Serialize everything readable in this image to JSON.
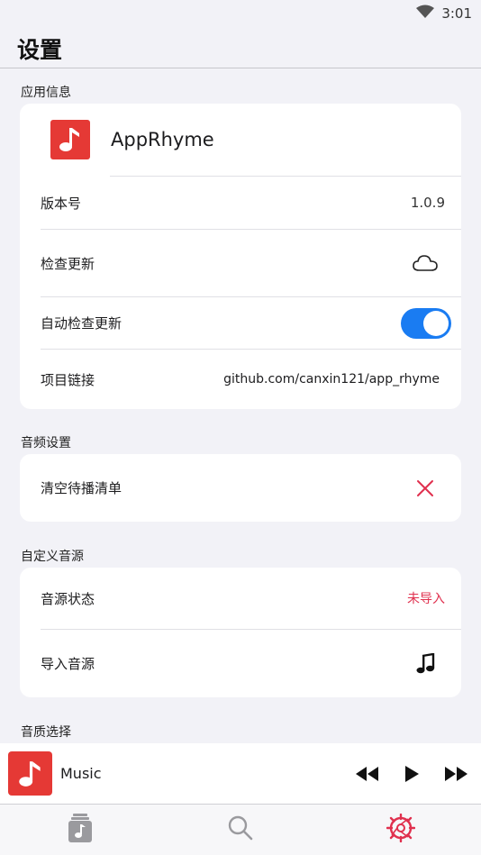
{
  "status": {
    "time": "3:01"
  },
  "page": {
    "title": "设置"
  },
  "sections": {
    "app_info": {
      "header": "应用信息",
      "app_name": "AppRhyme",
      "version_label": "版本号",
      "version_value": "1.0.9",
      "check_update_label": "检查更新",
      "auto_check_label": "自动检查更新",
      "auto_check_enabled": true,
      "project_link_label": "项目链接",
      "project_link_value": "github.com/canxin121/app_rhyme"
    },
    "audio": {
      "header": "音频设置",
      "clear_queue_label": "清空待播清单"
    },
    "custom_source": {
      "header": "自定义音源",
      "source_status_label": "音源状态",
      "source_status_value": "未导入",
      "import_source_label": "导入音源"
    },
    "quality": {
      "header": "音质选择"
    }
  },
  "mini_player": {
    "title": "Music"
  },
  "colors": {
    "accent_red": "#e53935",
    "toggle_blue": "#1a7cf2",
    "warning_red": "#e0304e"
  },
  "icons": {
    "wifi": "wifi-icon",
    "cloud": "cloud-icon",
    "close": "close-icon",
    "music_note": "music-note-icon",
    "prev": "skip-previous-icon",
    "play": "play-icon",
    "next": "skip-next-icon",
    "library": "music-library-icon",
    "search": "search-icon",
    "settings": "gear-icon"
  }
}
